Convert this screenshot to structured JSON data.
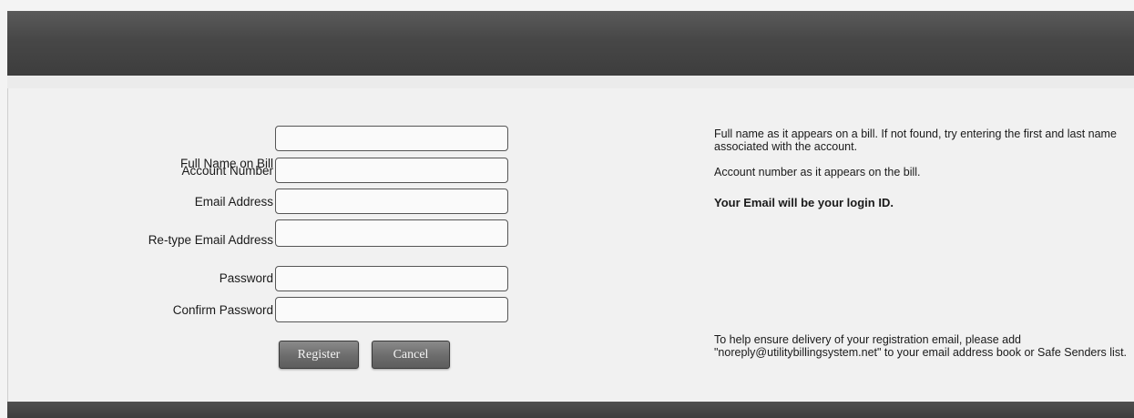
{
  "form": {
    "full_name_label": "Full Name on Bill",
    "full_name_value": "",
    "account_number_label": "Account Number",
    "account_number_value": "",
    "email_label": "Email Address",
    "email_value": "",
    "retype_email_label": "Re-type Email Address",
    "retype_email_value": "",
    "password_label": "Password",
    "password_value": "",
    "confirm_password_label": "Confirm Password",
    "confirm_password_value": ""
  },
  "buttons": {
    "register_label": "Register",
    "cancel_label": "Cancel"
  },
  "help": {
    "full_name": "Full name as it appears on a bill. If not found, try entering the first and last name associated with the account.",
    "account_number": "Account number as it appears on the bill.",
    "email": "Your Email will be your login ID.",
    "delivery": "To help ensure delivery of your registration email, please add \"noreply@utilitybillingsystem.net\" to your email address book or Safe Senders list."
  },
  "colors": {
    "header": "#474747",
    "button": "#6c6c6c"
  }
}
